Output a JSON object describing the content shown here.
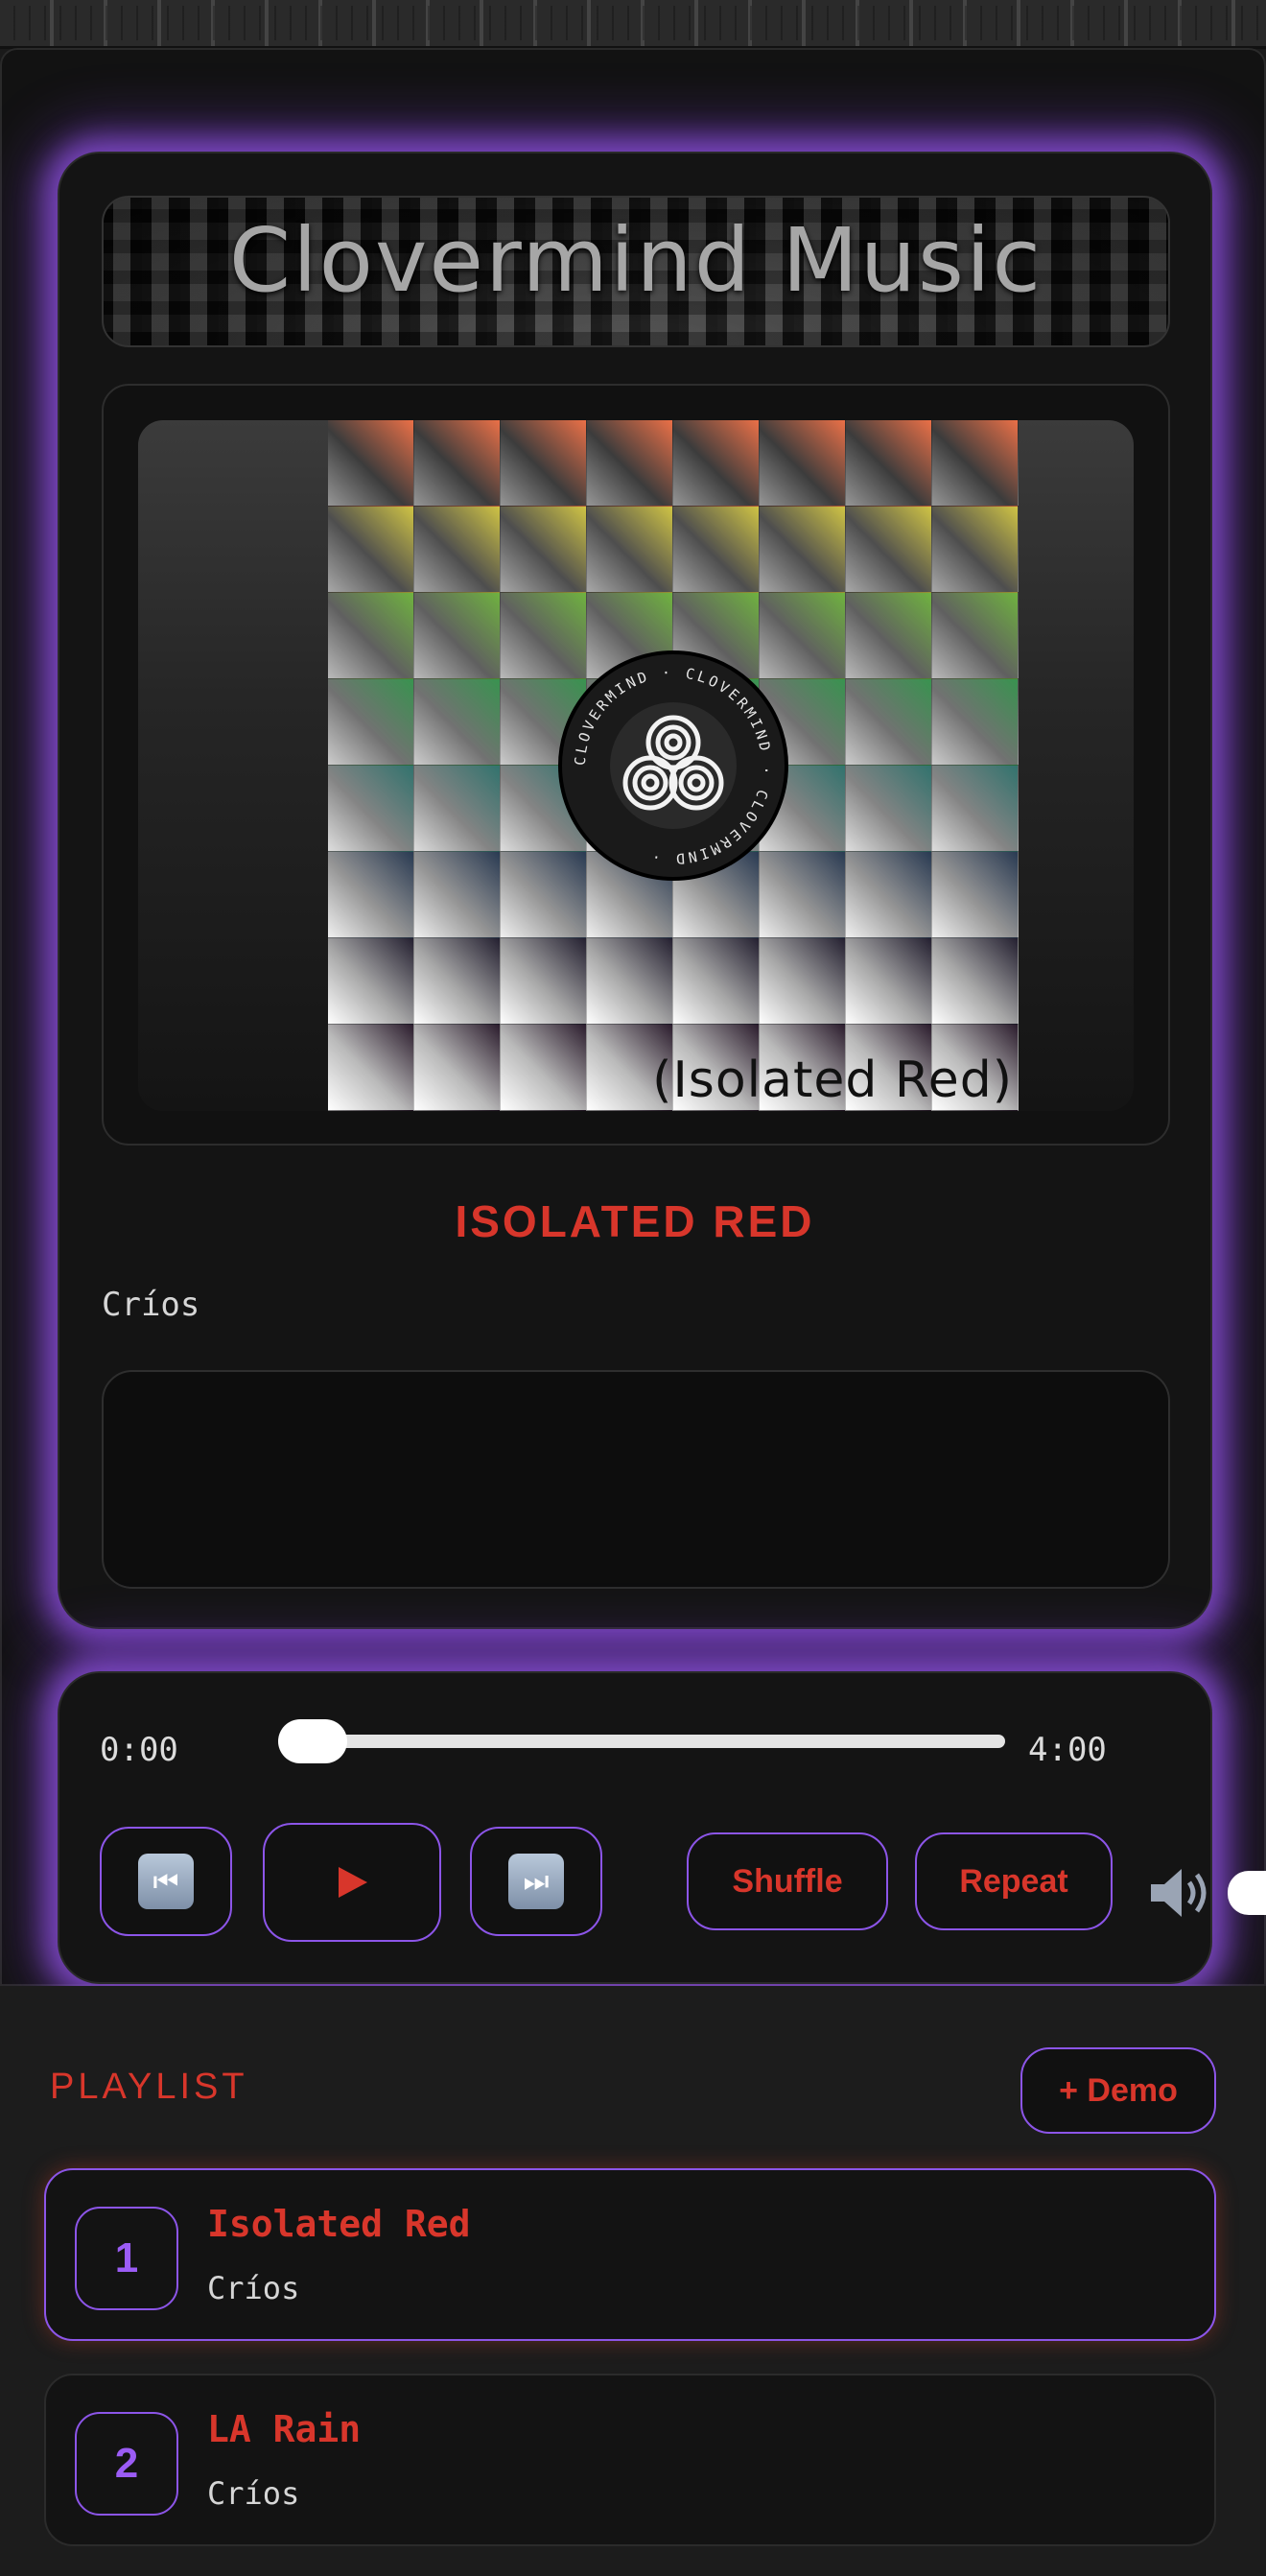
{
  "app": {
    "banner_title": "Clovermind Music"
  },
  "now_playing": {
    "title": "ISOLATED RED",
    "artist": "Críos",
    "artwork_label": "(Isolated Red)",
    "emblem_text": "CLOVERMIND"
  },
  "player": {
    "current_time": "0:00",
    "duration": "4:00",
    "progress": 0,
    "prev_icon": "previous-track-icon",
    "play_icon": "play-icon",
    "next_icon": "next-track-icon",
    "shuffle_label": "Shuffle",
    "repeat_label": "Repeat",
    "volume_icon": "speaker-icon"
  },
  "playlist": {
    "heading": "PLAYLIST",
    "demo_label": "+ Demo",
    "items": [
      {
        "number": "1",
        "title": "Isolated Red",
        "artist": "Críos",
        "active": true
      },
      {
        "number": "2",
        "title": "LA Rain",
        "artist": "Críos",
        "active": false
      }
    ]
  },
  "colors": {
    "accent_red": "#d8362b",
    "accent_purple": "#8c55e8",
    "glow_purple": "#7a4fd0",
    "background": "#121212"
  }
}
